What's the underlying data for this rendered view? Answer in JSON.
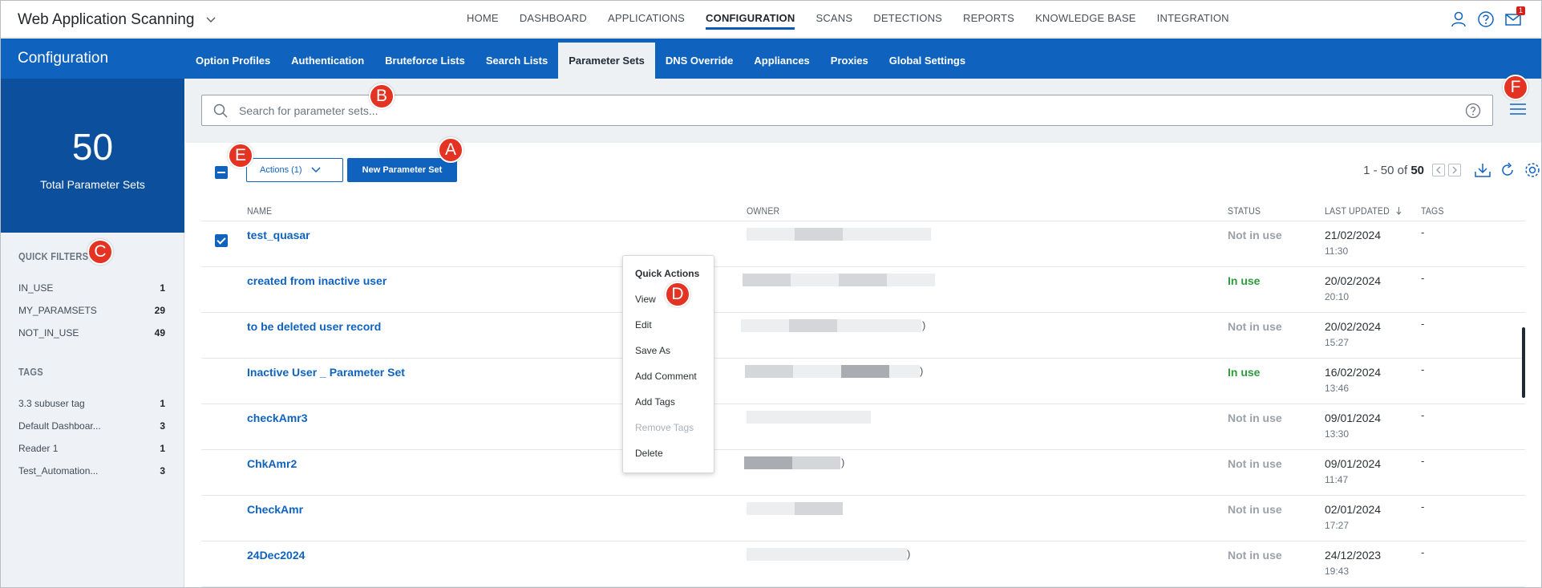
{
  "app": {
    "title": "Web Application Scanning"
  },
  "nav": {
    "items": [
      "HOME",
      "DASHBOARD",
      "APPLICATIONS",
      "CONFIGURATION",
      "SCANS",
      "DETECTIONS",
      "REPORTS",
      "KNOWLEDGE BASE",
      "INTEGRATION"
    ],
    "active": "CONFIGURATION",
    "mail_badge": "1"
  },
  "section": {
    "title": "Configuration",
    "tabs": [
      "Option Profiles",
      "Authentication",
      "Bruteforce Lists",
      "Search Lists",
      "Parameter Sets",
      "DNS Override",
      "Appliances",
      "Proxies",
      "Global Settings"
    ],
    "active_tab": "Parameter Sets"
  },
  "sidebar": {
    "total_count": "50",
    "total_label": "Total Parameter Sets",
    "quick_filters_heading": "QUICK FILTERS",
    "quick_filters": [
      {
        "label": "IN_USE",
        "count": "1"
      },
      {
        "label": "MY_PARAMSETS",
        "count": "29"
      },
      {
        "label": "NOT_IN_USE",
        "count": "49"
      }
    ],
    "tags_heading": "TAGS",
    "tags": [
      {
        "label": "3.3 subuser tag",
        "count": "1"
      },
      {
        "label": "Default Dashboar...",
        "count": "3"
      },
      {
        "label": "Reader 1",
        "count": "1"
      },
      {
        "label": "Test_Automation...",
        "count": "3"
      }
    ]
  },
  "search": {
    "placeholder": "Search for parameter sets..."
  },
  "toolbar": {
    "actions_label": "Actions (1)",
    "new_label": "New Parameter Set",
    "pager_range": "1 - 50 of",
    "pager_total": "50"
  },
  "table": {
    "columns": {
      "name": "NAME",
      "owner": "OWNER",
      "status": "STATUS",
      "last_updated": "LAST UPDATED",
      "tags": "TAGS"
    },
    "rows": [
      {
        "name": "test_quasar",
        "owner_tail": "",
        "status": "Not in use",
        "date": "21/02/2024",
        "time": "11:30",
        "tags": "-",
        "checked": true
      },
      {
        "name": "created from inactive user",
        "owner_tail": "",
        "status": "In use",
        "date": "20/02/2024",
        "time": "20:10",
        "tags": "-",
        "checked": false
      },
      {
        "name": "to be deleted user record",
        "owner_tail": ")",
        "status": "Not in use",
        "date": "20/02/2024",
        "time": "15:27",
        "tags": "-",
        "checked": false
      },
      {
        "name": "Inactive User _ Parameter Set",
        "owner_tail": ")",
        "status": "In use",
        "date": "16/02/2024",
        "time": "13:46",
        "tags": "-",
        "checked": false
      },
      {
        "name": "checkAmr3",
        "owner_tail": "",
        "status": "Not in use",
        "date": "09/01/2024",
        "time": "13:30",
        "tags": "-",
        "checked": false
      },
      {
        "name": "ChkAmr2",
        "owner_tail": ")",
        "status": "Not in use",
        "date": "09/01/2024",
        "time": "11:47",
        "tags": "-",
        "checked": false
      },
      {
        "name": "CheckAmr",
        "owner_tail": "",
        "status": "Not in use",
        "date": "02/01/2024",
        "time": "17:27",
        "tags": "-",
        "checked": false
      },
      {
        "name": "24Dec2024",
        "owner_tail": ")",
        "status": "Not in use",
        "date": "24/12/2023",
        "time": "19:43",
        "tags": "-",
        "checked": false
      }
    ]
  },
  "context_menu": {
    "title": "Quick Actions",
    "items": [
      {
        "label": "View",
        "disabled": false
      },
      {
        "label": "Edit",
        "disabled": false
      },
      {
        "label": "Save As",
        "disabled": false
      },
      {
        "label": "Add Comment",
        "disabled": false
      },
      {
        "label": "Add Tags",
        "disabled": false
      },
      {
        "label": "Remove Tags",
        "disabled": true
      },
      {
        "label": "Delete",
        "disabled": false
      }
    ]
  },
  "markers": [
    "A",
    "B",
    "C",
    "D",
    "E",
    "F"
  ],
  "colors": {
    "primary": "#0f63bf",
    "sidebar_total_bg": "#0b4f9d",
    "in_use": "#2e9b3c",
    "not_in_use": "#9aa1a8",
    "marker": "#e53323"
  }
}
